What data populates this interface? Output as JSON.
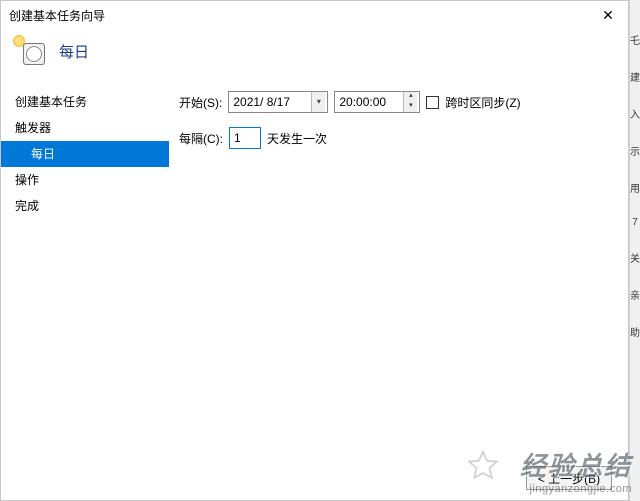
{
  "window": {
    "title": "创建基本任务向导"
  },
  "header": {
    "title": "每日"
  },
  "sidebar": {
    "items": [
      {
        "label": "创建基本任务"
      },
      {
        "label": "触发器"
      },
      {
        "label": "每日",
        "selected": true
      },
      {
        "label": "操作"
      },
      {
        "label": "完成"
      }
    ]
  },
  "form": {
    "start_label": "开始(S):",
    "date_value": "2021/ 8/17",
    "time_value": "20:00:00",
    "sync_tz_label": "跨时区同步(Z)",
    "sync_tz_checked": false,
    "interval_label": "每隔(C):",
    "interval_value": "1",
    "interval_suffix": "天发生一次"
  },
  "buttons": {
    "back": "< 上一步(B)"
  },
  "right_strip": [
    "乇",
    "建",
    "入",
    "示",
    "用",
    "7",
    "关",
    "亲",
    "助"
  ],
  "watermark": {
    "cn": "经验总结",
    "en": "jingyanzongjie.com"
  }
}
